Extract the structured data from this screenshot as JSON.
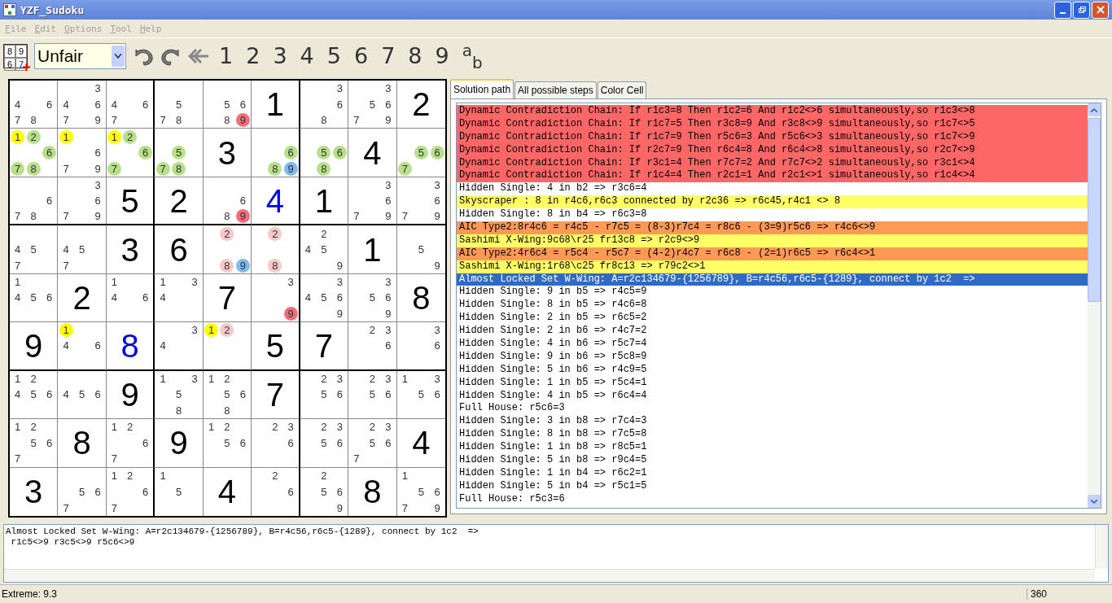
{
  "window": {
    "title": "YZF_Sudoku"
  },
  "menu": [
    {
      "label": "File",
      "disabled": true
    },
    {
      "label": "Edit",
      "disabled": true
    },
    {
      "label": "Options",
      "disabled": true
    },
    {
      "label": "Tool",
      "disabled": true
    },
    {
      "label": "Help",
      "disabled": true
    }
  ],
  "toolbar": {
    "icon_digits": [
      "8",
      "9",
      "6",
      "7"
    ],
    "difficulty": "Unfair",
    "digits": [
      "1",
      "2",
      "3",
      "4",
      "5",
      "6",
      "7",
      "8",
      "9"
    ],
    "notation": "$^{a}$$_{b}$"
  },
  "board": {
    "rows": [
      [
        {
          "candidates": [
            {
              "d": "4"
            },
            {
              "d": "6"
            },
            {
              "d": "7"
            },
            {
              "d": "8"
            }
          ]
        },
        {
          "candidates": [
            {
              "d": "3"
            },
            {
              "d": "4"
            },
            {
              "d": "6"
            },
            {
              "d": "7"
            },
            {
              "d": "9"
            }
          ]
        },
        {
          "candidates": [
            {
              "d": "4"
            },
            {
              "d": "6"
            },
            {
              "d": "7"
            }
          ]
        },
        {
          "candidates": [
            {
              "d": "5"
            },
            {
              "d": "7"
            },
            {
              "d": "8"
            }
          ]
        },
        {
          "candidates": [
            {
              "d": "5"
            },
            {
              "d": "6"
            },
            {
              "d": "8"
            },
            {
              "d": "9",
              "color": "#f0707a"
            }
          ]
        },
        {
          "value": "1",
          "kind": "given"
        },
        {
          "candidates": [
            {
              "d": "3"
            },
            {
              "d": "6"
            },
            {
              "d": "8"
            }
          ]
        },
        {
          "candidates": [
            {
              "d": "3"
            },
            {
              "d": "5"
            },
            {
              "d": "6"
            },
            {
              "d": "7"
            },
            {
              "d": "9"
            }
          ]
        },
        {
          "value": "2",
          "kind": "given"
        }
      ],
      [
        {
          "candidates": [
            {
              "d": "1",
              "color": "#ffff00"
            },
            {
              "d": "2",
              "color": "#b8e08a"
            },
            {
              "d": "6",
              "color": "#b8e08a"
            },
            {
              "d": "7",
              "color": "#b8e08a"
            },
            {
              "d": "8",
              "color": "#b8e08a"
            }
          ]
        },
        {
          "candidates": [
            {
              "d": "1",
              "color": "#ffff00"
            },
            {
              "d": "6"
            },
            {
              "d": "7"
            },
            {
              "d": "9"
            }
          ]
        },
        {
          "candidates": [
            {
              "d": "1",
              "color": "#ffff00"
            },
            {
              "d": "2",
              "color": "#b8e08a"
            },
            {
              "d": "6",
              "color": "#b8e08a"
            },
            {
              "d": "7",
              "color": "#b8e08a"
            }
          ]
        },
        {
          "candidates": [
            {
              "d": "5",
              "color": "#b8e08a"
            },
            {
              "d": "7",
              "color": "#b8e08a"
            },
            {
              "d": "8",
              "color": "#b8e08a"
            }
          ]
        },
        {
          "value": "3",
          "kind": "given"
        },
        {
          "candidates": [
            {
              "d": "6",
              "color": "#b8e08a"
            },
            {
              "d": "8",
              "color": "#b8e08a"
            },
            {
              "d": "9",
              "color": "#80b8f0"
            }
          ]
        },
        {
          "candidates": [
            {
              "d": "5",
              "color": "#b8e08a"
            },
            {
              "d": "6",
              "color": "#b8e08a"
            },
            {
              "d": "8",
              "color": "#b8e08a"
            }
          ]
        },
        {
          "value": "4",
          "kind": "given"
        },
        {
          "candidates": [
            {
              "d": "5",
              "color": "#b8e08a"
            },
            {
              "d": "6",
              "color": "#b8e08a"
            },
            {
              "d": "7",
              "color": "#b8e08a"
            }
          ]
        }
      ],
      [
        {
          "candidates": [
            {
              "d": "6"
            },
            {
              "d": "7"
            },
            {
              "d": "8"
            }
          ]
        },
        {
          "candidates": [
            {
              "d": "3"
            },
            {
              "d": "6"
            },
            {
              "d": "7"
            },
            {
              "d": "9"
            }
          ]
        },
        {
          "value": "5",
          "kind": "given"
        },
        {
          "value": "2",
          "kind": "given"
        },
        {
          "candidates": [
            {
              "d": "6"
            },
            {
              "d": "8"
            },
            {
              "d": "9",
              "color": "#f0707a"
            }
          ]
        },
        {
          "value": "4",
          "kind": "placed"
        },
        {
          "value": "1",
          "kind": "given"
        },
        {
          "candidates": [
            {
              "d": "3"
            },
            {
              "d": "6"
            },
            {
              "d": "7"
            },
            {
              "d": "9"
            }
          ]
        },
        {
          "candidates": [
            {
              "d": "3"
            },
            {
              "d": "6"
            },
            {
              "d": "7"
            },
            {
              "d": "9"
            }
          ]
        }
      ],
      [
        {
          "candidates": [
            {
              "d": "4"
            },
            {
              "d": "5"
            },
            {
              "d": "7"
            }
          ]
        },
        {
          "candidates": [
            {
              "d": "4"
            },
            {
              "d": "5"
            },
            {
              "d": "7"
            }
          ]
        },
        {
          "value": "3",
          "kind": "given"
        },
        {
          "value": "6",
          "kind": "given"
        },
        {
          "candidates": [
            {
              "d": "2",
              "color": "#f8c8c8"
            },
            {
              "d": "8",
              "color": "#f8c8c8"
            },
            {
              "d": "9",
              "color": "#80b8f0"
            }
          ]
        },
        {
          "candidates": [
            {
              "d": "2",
              "color": "#f8c8c8"
            },
            {
              "d": "8",
              "color": "#f8c8c8"
            }
          ]
        },
        {
          "candidates": [
            {
              "d": "2"
            },
            {
              "d": "4"
            },
            {
              "d": "5"
            },
            {
              "d": "9"
            }
          ]
        },
        {
          "value": "1",
          "kind": "given"
        },
        {
          "candidates": [
            {
              "d": "5"
            },
            {
              "d": "9"
            }
          ]
        }
      ],
      [
        {
          "candidates": [
            {
              "d": "1"
            },
            {
              "d": "4"
            },
            {
              "d": "5"
            },
            {
              "d": "6"
            }
          ]
        },
        {
          "value": "2",
          "kind": "given"
        },
        {
          "candidates": [
            {
              "d": "1"
            },
            {
              "d": "4"
            },
            {
              "d": "6"
            }
          ]
        },
        {
          "candidates": [
            {
              "d": "1"
            },
            {
              "d": "3"
            },
            {
              "d": "4"
            }
          ]
        },
        {
          "value": "7",
          "kind": "given"
        },
        {
          "candidates": [
            {
              "d": "3"
            },
            {
              "d": "9",
              "color": "#f0707a"
            }
          ]
        },
        {
          "candidates": [
            {
              "d": "3"
            },
            {
              "d": "4"
            },
            {
              "d": "5"
            },
            {
              "d": "6"
            },
            {
              "d": "9"
            }
          ]
        },
        {
          "candidates": [
            {
              "d": "3"
            },
            {
              "d": "5"
            },
            {
              "d": "6"
            },
            {
              "d": "9"
            }
          ]
        },
        {
          "value": "8",
          "kind": "given"
        }
      ],
      [
        {
          "value": "9",
          "kind": "given"
        },
        {
          "candidates": [
            {
              "d": "1",
              "color": "#ffff00"
            },
            {
              "d": "4"
            },
            {
              "d": "6"
            }
          ]
        },
        {
          "value": "8",
          "kind": "placed"
        },
        {
          "candidates": [
            {
              "d": "3"
            },
            {
              "d": "4"
            }
          ]
        },
        {
          "candidates": [
            {
              "d": "1",
              "color": "#ffff00"
            },
            {
              "d": "2",
              "color": "#f8c8c8"
            }
          ]
        },
        {
          "value": "5",
          "kind": "given"
        },
        {
          "value": "7",
          "kind": "given"
        },
        {
          "candidates": [
            {
              "d": "2"
            },
            {
              "d": "3"
            },
            {
              "d": "6"
            }
          ]
        },
        {
          "candidates": [
            {
              "d": "3"
            },
            {
              "d": "6"
            }
          ]
        }
      ],
      [
        {
          "candidates": [
            {
              "d": "1"
            },
            {
              "d": "2"
            },
            {
              "d": "4"
            },
            {
              "d": "5"
            },
            {
              "d": "6"
            }
          ]
        },
        {
          "candidates": [
            {
              "d": "4"
            },
            {
              "d": "5"
            },
            {
              "d": "6"
            }
          ]
        },
        {
          "value": "9",
          "kind": "given"
        },
        {
          "candidates": [
            {
              "d": "1"
            },
            {
              "d": "3"
            },
            {
              "d": "5"
            },
            {
              "d": "8"
            }
          ]
        },
        {
          "candidates": [
            {
              "d": "1"
            },
            {
              "d": "2"
            },
            {
              "d": "5"
            },
            {
              "d": "6"
            },
            {
              "d": "8"
            }
          ]
        },
        {
          "value": "7",
          "kind": "given"
        },
        {
          "candidates": [
            {
              "d": "2"
            },
            {
              "d": "3"
            },
            {
              "d": "5"
            },
            {
              "d": "6"
            }
          ]
        },
        {
          "candidates": [
            {
              "d": "2"
            },
            {
              "d": "3"
            },
            {
              "d": "5"
            },
            {
              "d": "6"
            }
          ]
        },
        {
          "candidates": [
            {
              "d": "1"
            },
            {
              "d": "3"
            },
            {
              "d": "5"
            },
            {
              "d": "6"
            }
          ]
        }
      ],
      [
        {
          "candidates": [
            {
              "d": "1"
            },
            {
              "d": "2"
            },
            {
              "d": "5"
            },
            {
              "d": "6"
            },
            {
              "d": "7"
            }
          ]
        },
        {
          "value": "8",
          "kind": "given"
        },
        {
          "candidates": [
            {
              "d": "1"
            },
            {
              "d": "2"
            },
            {
              "d": "6"
            },
            {
              "d": "7"
            }
          ]
        },
        {
          "value": "9",
          "kind": "given"
        },
        {
          "candidates": [
            {
              "d": "1"
            },
            {
              "d": "2"
            },
            {
              "d": "5"
            },
            {
              "d": "6"
            }
          ]
        },
        {
          "candidates": [
            {
              "d": "2"
            },
            {
              "d": "3"
            },
            {
              "d": "6"
            }
          ]
        },
        {
          "candidates": [
            {
              "d": "2"
            },
            {
              "d": "3"
            },
            {
              "d": "5"
            },
            {
              "d": "6"
            }
          ]
        },
        {
          "candidates": [
            {
              "d": "2"
            },
            {
              "d": "3"
            },
            {
              "d": "5"
            },
            {
              "d": "6"
            },
            {
              "d": "7"
            }
          ]
        },
        {
          "value": "4",
          "kind": "given"
        }
      ],
      [
        {
          "value": "3",
          "kind": "given"
        },
        {
          "candidates": [
            {
              "d": "5"
            },
            {
              "d": "6"
            },
            {
              "d": "7"
            }
          ]
        },
        {
          "candidates": [
            {
              "d": "1"
            },
            {
              "d": "2"
            },
            {
              "d": "6"
            },
            {
              "d": "7"
            }
          ]
        },
        {
          "candidates": [
            {
              "d": "1"
            },
            {
              "d": "5"
            }
          ]
        },
        {
          "value": "4",
          "kind": "given"
        },
        {
          "candidates": [
            {
              "d": "2"
            },
            {
              "d": "6"
            }
          ]
        },
        {
          "candidates": [
            {
              "d": "2"
            },
            {
              "d": "5"
            },
            {
              "d": "6"
            },
            {
              "d": "9"
            }
          ]
        },
        {
          "value": "8",
          "kind": "given"
        },
        {
          "candidates": [
            {
              "d": "1"
            },
            {
              "d": "5"
            },
            {
              "d": "6"
            },
            {
              "d": "7"
            },
            {
              "d": "9"
            }
          ]
        }
      ]
    ]
  },
  "tabs": [
    {
      "label": "Solution path",
      "selected": true
    },
    {
      "label": "All possible steps",
      "selected": false
    },
    {
      "label": "Color Cell",
      "selected": false
    }
  ],
  "steps": [
    {
      "text": "Dynamic Contradiction Chain: If r1c3=8 Then r1c2=6 And r1c2<>6 simultaneously,so r1c3<>8",
      "color": "#ff6666",
      "selected": false
    },
    {
      "text": "Dynamic Contradiction Chain: If r1c7=5 Then r3c8=9 And r3c8<>9 simultaneously,so r1c7<>5",
      "color": "#ff6666",
      "selected": false
    },
    {
      "text": "Dynamic Contradiction Chain: If r1c7=9 Then r5c6=3 And r5c6<>3 simultaneously,so r1c7<>9",
      "color": "#ff6666",
      "selected": false
    },
    {
      "text": "Dynamic Contradiction Chain: If r2c7=9 Then r6c4=8 And r6c4<>8 simultaneously,so r2c7<>9",
      "color": "#ff6666",
      "selected": false
    },
    {
      "text": "Dynamic Contradiction Chain: If r3c1=4 Then r7c7=2 And r7c7<>2 simultaneously,so r3c1<>4",
      "color": "#ff6666",
      "selected": false
    },
    {
      "text": "Dynamic Contradiction Chain: If r1c4=4 Then r2c1=1 And r2c1<>1 simultaneously,so r1c4<>4",
      "color": "#ff6666",
      "selected": false
    },
    {
      "text": "Hidden Single: 4 in b2 => r3c6=4",
      "color": "#ffffff",
      "selected": false
    },
    {
      "text": "Skyscraper : 8 in r4c6,r6c3 connected by r2c36 => r6c45,r4c1 <> 8",
      "color": "#ffff66",
      "selected": false
    },
    {
      "text": "Hidden Single: 8 in b4 => r6c3=8",
      "color": "#ffffff",
      "selected": false
    },
    {
      "text": "AIC Type2:8r4c6 = r4c5 - r7c5 = (8-3)r7c4 = r8c6 - (3=9)r5c6 => r4c6<>9",
      "color": "#ff9955",
      "selected": false
    },
    {
      "text": "Sashimi X-Wing:9c68\\r25 fr13c8 => r2c9<>9",
      "color": "#ffff66",
      "selected": false
    },
    {
      "text": "AIC Type2:4r6c4 = r5c4 - r5c7 = (4-2)r4c7 = r6c8 - (2=1)r6c5 => r6c4<>1",
      "color": "#ff9955",
      "selected": false
    },
    {
      "text": "Sashimi X-Wing:1r68\\c25 fr8c13 => r79c2<>1",
      "color": "#ffff66",
      "selected": false
    },
    {
      "text": "Almost Locked Set W-Wing: A=r2c134679-{1256789}, B=r4c56,r6c5-{1289}, connect by 1c2  =>",
      "selected": true
    },
    {
      "text": "Hidden Single: 9 in b5 => r4c5=9",
      "color": "#ffffff",
      "selected": false
    },
    {
      "text": "Hidden Single: 8 in b5 => r4c6=8",
      "color": "#ffffff",
      "selected": false
    },
    {
      "text": "Hidden Single: 2 in b5 => r6c5=2",
      "color": "#ffffff",
      "selected": false
    },
    {
      "text": "Hidden Single: 2 in b6 => r4c7=2",
      "color": "#ffffff",
      "selected": false
    },
    {
      "text": "Hidden Single: 4 in b6 => r5c7=4",
      "color": "#ffffff",
      "selected": false
    },
    {
      "text": "Hidden Single: 9 in b6 => r5c8=9",
      "color": "#ffffff",
      "selected": false
    },
    {
      "text": "Hidden Single: 5 in b6 => r4c9=5",
      "color": "#ffffff",
      "selected": false
    },
    {
      "text": "Hidden Single: 1 in b5 => r5c4=1",
      "color": "#ffffff",
      "selected": false
    },
    {
      "text": "Hidden Single: 4 in b5 => r6c4=4",
      "color": "#ffffff",
      "selected": false
    },
    {
      "text": "Full House: r5c6=3",
      "color": "#ffffff",
      "selected": false
    },
    {
      "text": "Hidden Single: 3 in b8 => r7c4=3",
      "color": "#ffffff",
      "selected": false
    },
    {
      "text": "Hidden Single: 8 in b8 => r7c5=8",
      "color": "#ffffff",
      "selected": false
    },
    {
      "text": "Hidden Single: 1 in b8 => r8c5=1",
      "color": "#ffffff",
      "selected": false
    },
    {
      "text": "Hidden Single: 5 in b8 => r9c4=5",
      "color": "#ffffff",
      "selected": false
    },
    {
      "text": "Hidden Single: 1 in b4 => r6c2=1",
      "color": "#ffffff",
      "selected": false
    },
    {
      "text": "Hidden Single: 5 in b4 => r5c1=5",
      "color": "#ffffff",
      "selected": false
    },
    {
      "text": "Full House: r5c3=6",
      "color": "#ffffff",
      "selected": false
    }
  ],
  "detail": {
    "lines": [
      "Almost Locked Set W-Wing: A=r2c134679-{1256789}, B=r4c56,r6c5-{1289}, connect by 1c2  =>",
      " r1c5<>9 r3c5<>9 r5c6<>9"
    ]
  },
  "status_bar": {
    "rating": "Extreme: 9.3",
    "count": "360"
  }
}
